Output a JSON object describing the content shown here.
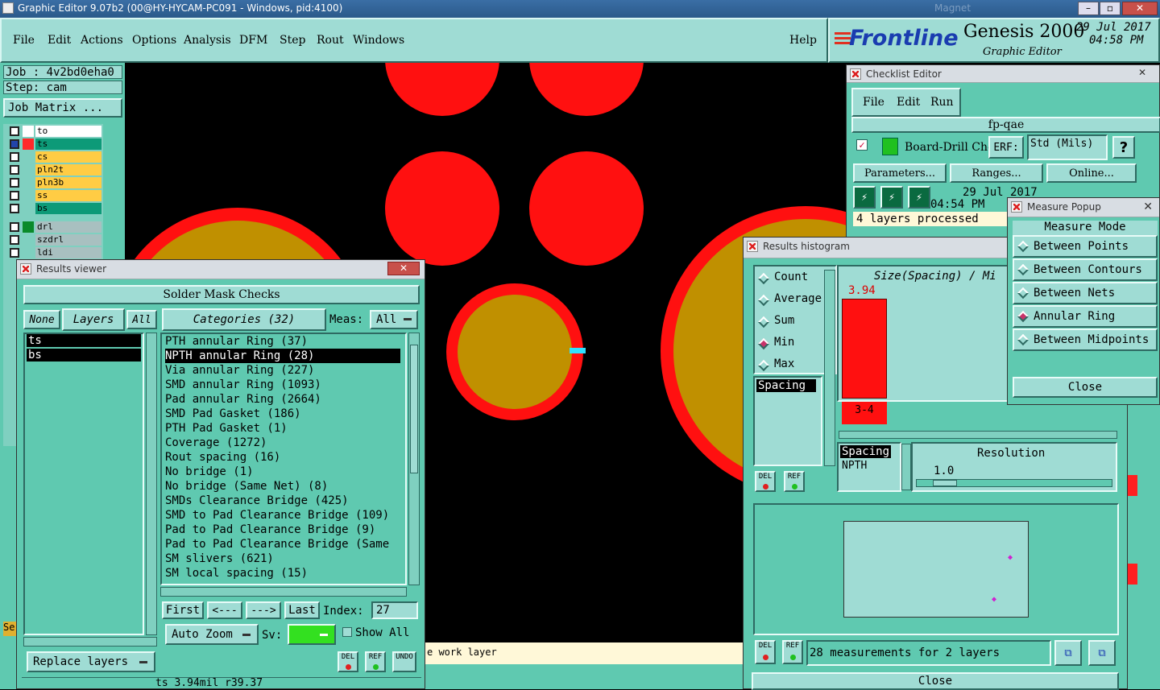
{
  "titlebar": {
    "title": "Graphic Editor 9.07b2 (00@HY-HYCAM-PC091 - Windows, pid:4100)",
    "faded": "Magnet"
  },
  "menubar": {
    "items": [
      "File",
      "Edit",
      "Actions",
      "Options",
      "Analysis",
      "DFM",
      "Step",
      "Rout",
      "Windows"
    ],
    "help": "Help"
  },
  "brand": {
    "logo": "Frontline",
    "product": "Genesis 2000",
    "subtitle": "Graphic Editor",
    "date": "29 Jul 2017",
    "time": "04:58 PM"
  },
  "leftpanel": {
    "job": "Job : 4v2bd0eha0",
    "step": "Step: cam",
    "job_matrix": "Job Matrix ...",
    "layers": [
      {
        "name": "to",
        "color": "#ffffff",
        "swatch": "#ffffff"
      },
      {
        "name": "ts",
        "color": "#0d9a78",
        "swatch": "#ff2a2a"
      },
      {
        "name": "cs",
        "color": "#ffcc44",
        "swatch": "#ffffff"
      },
      {
        "name": "pln2t",
        "color": "#ffcc44",
        "swatch": "#ffffff"
      },
      {
        "name": "pln3b",
        "color": "#ffcc44",
        "swatch": "#ffffff"
      },
      {
        "name": "ss",
        "color": "#ffcc44",
        "swatch": "#ffffff"
      },
      {
        "name": "bs",
        "color": "#0d9a78",
        "swatch": "#ffffff"
      },
      {
        "name": "drl",
        "color": "#a8c0c0",
        "swatch": "#0a8a2a"
      },
      {
        "name": "szdrl",
        "color": "#a8c0c0",
        "swatch": "#ffffff"
      },
      {
        "name": "ldi",
        "color": "#a8c0c0",
        "swatch": "#ffffff"
      }
    ],
    "se_label": "Se"
  },
  "results_viewer": {
    "title": "Results viewer",
    "header": "Solder Mask Checks",
    "none": "None",
    "layers_btn": "Layers",
    "all": "All",
    "categories_btn": "Categories (32)",
    "meas_label": "Meas:",
    "meas_value": "All",
    "layer_list": [
      "ts",
      "bs"
    ],
    "categories": [
      "PTH annular Ring (37)",
      "NPTH annular Ring (28)",
      "Via annular Ring (227)",
      "SMD annular Ring (1093)",
      "Pad annular Ring (2664)",
      "SMD Pad Gasket (186)",
      "PTH Pad Gasket (1)",
      "Coverage (1272)",
      "Rout spacing (16)",
      "No bridge (1)",
      "No bridge (Same Net) (8)",
      "SMDs Clearance Bridge (425)",
      "SMD to Pad Clearance Bridge (109)",
      "Pad to Pad Clearance Bridge (9)",
      "Pad to Pad Clearance Bridge (Same",
      "SM slivers (621)",
      "SM local spacing (15)"
    ],
    "selected_index": 1,
    "first": "First",
    "prev": "<---",
    "next": "--->",
    "last": "Last",
    "index_label": "Index:",
    "index_value": "27",
    "auto_zoom": "Auto Zoom",
    "sv": "Sv:",
    "show_all": "Show All",
    "replace_layers": "Replace layers",
    "del": "DEL",
    "ref": "REF",
    "undo": "UNDO",
    "status": "ts 3.94mil  r39.37"
  },
  "statusbar": {
    "text": "e work layer"
  },
  "checklist": {
    "title": "Checklist Editor",
    "menu": [
      "File",
      "Edit",
      "Run"
    ],
    "name": "fp-qae",
    "action": "Board-Drill Che",
    "erf": "ERF:",
    "erf_value": "Std (Mils)",
    "q": "?",
    "params": "Parameters...",
    "ranges": "Ranges...",
    "online": "Online...",
    "date": "29 Jul 2017",
    "time": "04:54 PM",
    "processed": "4 layers processed"
  },
  "histogram": {
    "title": "Results histogram",
    "modes": [
      "Count",
      "Average",
      "Sum",
      "Min",
      "Max"
    ],
    "selected_mode": "Min",
    "list": [
      "Spacing"
    ],
    "chart_title": "Size(Spacing) / Mi",
    "bar_value": "3.94",
    "bar_range": "3-4",
    "spacing_box": [
      "Spacing",
      "NPTH"
    ],
    "resolution_label": "Resolution",
    "resolution_value": "1.0",
    "del": "DEL",
    "ref": "REF",
    "measurements": "28 measurements for 2 layers",
    "close": "Close"
  },
  "measure": {
    "title": "Measure Popup",
    "header": "Measure Mode",
    "modes": [
      "Between Points",
      "Between Contours",
      "Between Nets",
      "Annular Ring",
      "Between Midpoints"
    ],
    "selected": "Annular Ring",
    "close": "Close"
  },
  "colors": {
    "pad_red": "#ff1010",
    "pad_gold": "#c09000",
    "teal": "#5fc9b0",
    "light_teal": "#9fdcd4",
    "brand_red": "#e03020",
    "brand_blue": "#1a3cb0"
  }
}
